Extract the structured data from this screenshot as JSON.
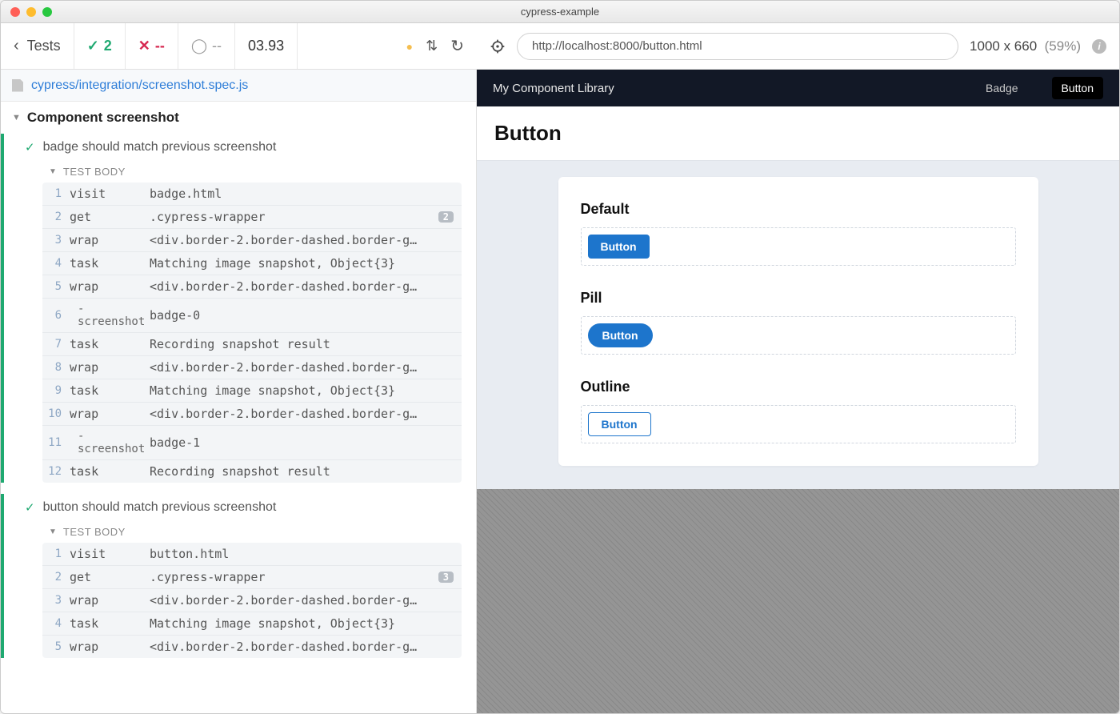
{
  "window_title": "cypress-example",
  "toolbar": {
    "back_label": "Tests",
    "pass_count": "2",
    "fail_count": "--",
    "pending_count": "--",
    "duration": "03.93"
  },
  "url_bar": {
    "value": "http://localhost:8000/button.html"
  },
  "viewport": {
    "dims": "1000 x 660",
    "scale": "(59%)"
  },
  "spec_path": "cypress/integration/screenshot.spec.js",
  "suite_title": "Component screenshot",
  "tests": [
    {
      "title": "badge should match previous screenshot",
      "body_label": "TEST BODY",
      "commands": [
        {
          "num": "1",
          "name": "visit",
          "msg": "badge.html"
        },
        {
          "num": "2",
          "name": "get",
          "msg": ".cypress-wrapper",
          "badge": "2"
        },
        {
          "num": "3",
          "name": "wrap",
          "msg": "<div.border-2.border-dashed.border-g…"
        },
        {
          "num": "4",
          "name": "task",
          "msg": "Matching image snapshot, Object{3}"
        },
        {
          "num": "5",
          "name": "wrap",
          "msg": "<div.border-2.border-dashed.border-g…"
        },
        {
          "num": "6",
          "name": "- screenshot",
          "indent": true,
          "msg": "badge-0"
        },
        {
          "num": "7",
          "name": "task",
          "msg": "Recording snapshot result"
        },
        {
          "num": "8",
          "name": "wrap",
          "msg": "<div.border-2.border-dashed.border-g…"
        },
        {
          "num": "9",
          "name": "task",
          "msg": "Matching image snapshot, Object{3}"
        },
        {
          "num": "10",
          "name": "wrap",
          "msg": "<div.border-2.border-dashed.border-g…"
        },
        {
          "num": "11",
          "name": "- screenshot",
          "indent": true,
          "msg": "badge-1"
        },
        {
          "num": "12",
          "name": "task",
          "msg": "Recording snapshot result"
        }
      ]
    },
    {
      "title": "button should match previous screenshot",
      "body_label": "TEST BODY",
      "commands": [
        {
          "num": "1",
          "name": "visit",
          "msg": "button.html"
        },
        {
          "num": "2",
          "name": "get",
          "msg": ".cypress-wrapper",
          "badge": "3"
        },
        {
          "num": "3",
          "name": "wrap",
          "msg": "<div.border-2.border-dashed.border-g…"
        },
        {
          "num": "4",
          "name": "task",
          "msg": "Matching image snapshot, Object{3}"
        },
        {
          "num": "5",
          "name": "wrap",
          "msg": "<div.border-2.border-dashed.border-g…"
        }
      ]
    }
  ],
  "app": {
    "brand": "My Component Library",
    "nav": {
      "badge": "Badge",
      "button": "Button"
    },
    "page_title": "Button",
    "variants": {
      "default": {
        "heading": "Default",
        "label": "Button"
      },
      "pill": {
        "heading": "Pill",
        "label": "Button"
      },
      "outline": {
        "heading": "Outline",
        "label": "Button"
      }
    }
  }
}
